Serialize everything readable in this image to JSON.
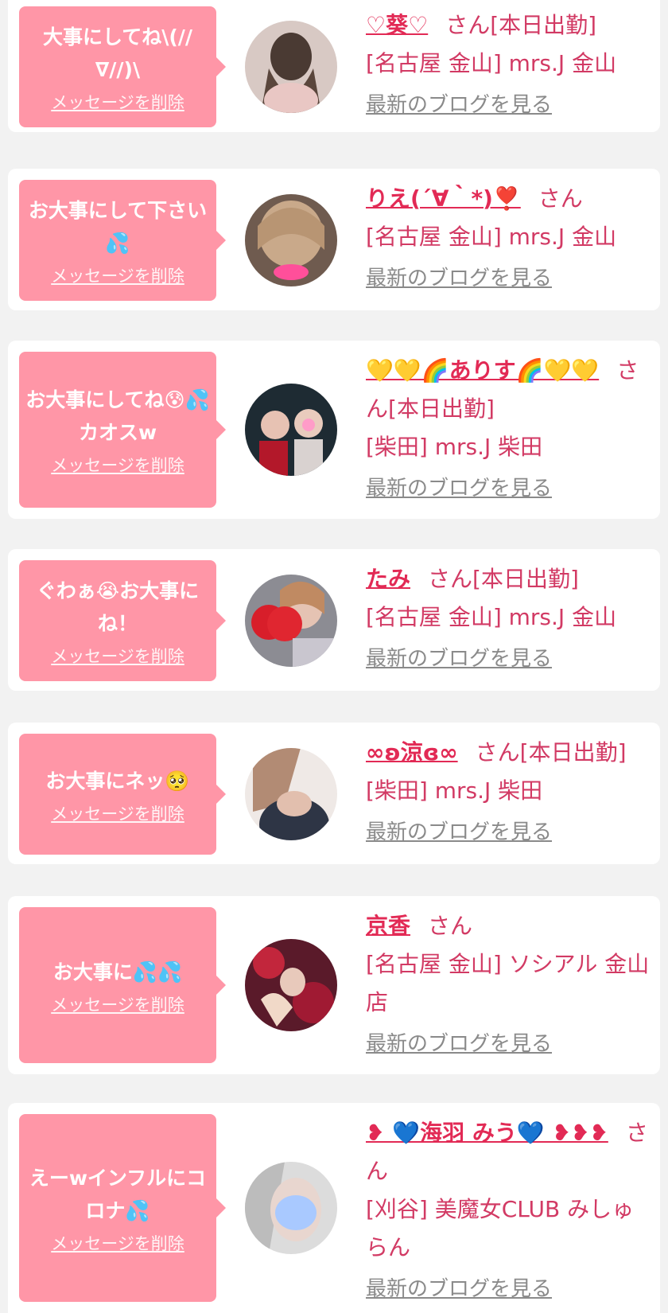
{
  "delete_label": "メッセージを削除",
  "blog_label": "最新のブログを見る",
  "honorific": "さん",
  "colors": {
    "page_bg": "#f2f2f2",
    "bubble_bg": "#ff96a7",
    "name": "#e22a55",
    "text": "#d23a64",
    "link_gray": "#8a8a8a"
  },
  "items": [
    {
      "message": "大事にしてね\\(// ∇//)\\",
      "name": "♡葵♡",
      "status": "[本日出勤]",
      "shop": "[名古屋 金山] mrs.J 金山"
    },
    {
      "message": "お大事にして下さい💦",
      "name": "りえ(´∀｀*)❣️",
      "status": "",
      "shop": "[名古屋 金山] mrs.J 金山"
    },
    {
      "message": "お大事にしてね😰💦カオスw",
      "name": "💛💛🌈ありす🌈💛💛",
      "status": "[本日出勤]",
      "shop": "[柴田] mrs.J 柴田"
    },
    {
      "message": "ぐわぁ😭お大事にね！",
      "name": "たみ",
      "status": "[本日出勤]",
      "shop": "[名古屋 金山] mrs.J 金山"
    },
    {
      "message": "お大事にネッ🥺",
      "name": "∞ʚ涼ɞ∞",
      "status": "[本日出勤]",
      "shop": "[柴田] mrs.J 柴田"
    },
    {
      "message": "お大事に💦💦",
      "name": "京香",
      "status": "",
      "shop": "[名古屋 金山] ソシアル 金山店"
    },
    {
      "message": "えーwインフルにコロナ💦",
      "name": "❥ 💙海羽 みう💙 ❥❥❥",
      "status": "",
      "shop": "[刈谷] 美魔女CLUB みしゅらん"
    }
  ]
}
